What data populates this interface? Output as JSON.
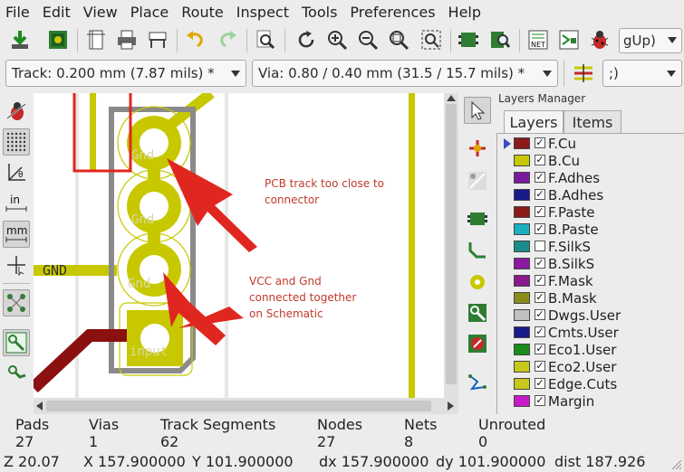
{
  "menu": [
    "File",
    "Edit",
    "View",
    "Place",
    "Route",
    "Inspect",
    "Tools",
    "Preferences",
    "Help"
  ],
  "toolbar": {
    "right_combo_value": "gUp)",
    "icons": [
      "save-board-icon",
      "board-setup-icon",
      "page-settings-icon",
      "plot-icon",
      "print-icon",
      "undo-icon",
      "redo-icon",
      "find-icon",
      "refresh-icon",
      "zoom-in-icon",
      "zoom-out-icon",
      "zoom-fit-icon",
      "zoom-selection-icon",
      "footprint-editor-icon",
      "footprint-browser-icon",
      "netlist-icon",
      "update-pcb-icon",
      "drc-icon"
    ]
  },
  "toolbar2": {
    "track_combo": "Track: 0.200 mm (7.87 mils) *",
    "via_combo": "Via: 0.80 / 0.40 mm (31.5 / 15.7 mils) *",
    "layer_combo": ";)"
  },
  "left_toolbar": {
    "inch_label": "in",
    "mm_label": "mm",
    "icons": [
      "drc-markers-icon",
      "grid-icon",
      "polar-coords-icon",
      "inch-units-icon",
      "mm-units-icon",
      "cursor-shape-icon",
      "ratsnest-icon",
      "show-tracks-icon",
      "show-vias-icon"
    ]
  },
  "canvas": {
    "gnd_label": "GND",
    "pad_labels": [
      "Gnd",
      "Gnd",
      "Gnd",
      "input"
    ],
    "annotation1": [
      "PCB track too close to",
      "connector"
    ],
    "annotation2": [
      "VCC and Gnd",
      "connected together",
      "on Schematic"
    ],
    "colors": {
      "track": "#c8c800",
      "dark_track": "#8b1010",
      "outline": "#8a8a8a",
      "highlight": "#e0271f",
      "annotation": "#c0392b"
    }
  },
  "right_toolbar": {
    "icons": [
      "select-arrow-icon",
      "highlight-net-icon",
      "local-ratsnest-icon",
      "add-footprint-icon",
      "route-track-icon",
      "add-via-icon",
      "add-zone-icon",
      "add-keepout-icon",
      "add-graphic-icon"
    ]
  },
  "layers_manager": {
    "title": "Layers Manager",
    "tabs": [
      "Layers",
      "Items"
    ],
    "layers": [
      {
        "name": "F.Cu",
        "color": "#8b1a1a",
        "checked": true,
        "selected": true
      },
      {
        "name": "B.Cu",
        "color": "#c8c800",
        "checked": true
      },
      {
        "name": "F.Adhes",
        "color": "#7b1a9e",
        "checked": true
      },
      {
        "name": "B.Adhes",
        "color": "#1a1a8b",
        "checked": true
      },
      {
        "name": "F.Paste",
        "color": "#8b1a1a",
        "checked": true
      },
      {
        "name": "B.Paste",
        "color": "#1ab0c0",
        "checked": true
      },
      {
        "name": "F.SilkS",
        "color": "#1a8b8b",
        "checked": false
      },
      {
        "name": "B.SilkS",
        "color": "#8b1a9e",
        "checked": true
      },
      {
        "name": "F.Mask",
        "color": "#8b1a8b",
        "checked": true
      },
      {
        "name": "B.Mask",
        "color": "#8b8b1a",
        "checked": true
      },
      {
        "name": "Dwgs.User",
        "color": "#c0c0c0",
        "checked": true
      },
      {
        "name": "Cmts.User",
        "color": "#1a1a8b",
        "checked": true
      },
      {
        "name": "Eco1.User",
        "color": "#1a8b1a",
        "checked": true
      },
      {
        "name": "Eco2.User",
        "color": "#c8c81a",
        "checked": true
      },
      {
        "name": "Edge.Cuts",
        "color": "#c8c81a",
        "checked": true
      },
      {
        "name": "Margin",
        "color": "#c81ac8",
        "checked": true
      }
    ]
  },
  "status": {
    "pads_label": "Pads",
    "pads_value": "27",
    "vias_label": "Vias",
    "vias_value": "1",
    "tracks_label": "Track Segments",
    "tracks_value": "62",
    "nodes_label": "Nodes",
    "nodes_value": "27",
    "nets_label": "Nets",
    "nets_value": "8",
    "unrouted_label": "Unrouted",
    "unrouted_value": "0",
    "zoom": "Z 20.07",
    "x": "X 157.900000",
    "y": "Y 101.900000",
    "dx": "dx 157.900000",
    "dy": "dy 101.900000",
    "dist": "dist 187.926"
  }
}
